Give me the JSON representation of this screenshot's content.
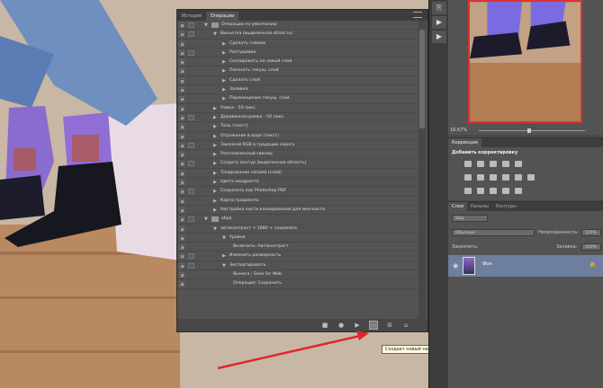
{
  "actions_panel": {
    "tabs": [
      "История",
      "Операции"
    ],
    "rows": [
      {
        "label": "Операции по умолчанию",
        "level": 0,
        "type": "set",
        "expanded": true,
        "dlg": true
      },
      {
        "label": "Виньетка (выделенная область)",
        "level": 1,
        "type": "action",
        "expanded": true,
        "dlg": true
      },
      {
        "label": "Сделать снимок",
        "level": 2,
        "type": "step",
        "expanded": false,
        "dlg": false
      },
      {
        "label": "Растушевка",
        "level": 2,
        "type": "step",
        "expanded": false,
        "dlg": true
      },
      {
        "label": "Скопировать на новый слой",
        "level": 2,
        "type": "step",
        "expanded": false,
        "dlg": false
      },
      {
        "label": "Показать текущ. слой",
        "level": 2,
        "type": "step",
        "expanded": false,
        "dlg": false
      },
      {
        "label": "Сделать слой",
        "level": 2,
        "type": "step",
        "expanded": false,
        "dlg": false
      },
      {
        "label": "Заливка",
        "level": 2,
        "type": "step",
        "expanded": false,
        "dlg": false
      },
      {
        "label": "Перемещение текущ. слой",
        "level": 2,
        "type": "step",
        "expanded": false,
        "dlg": false
      },
      {
        "label": "Рамка - 50 пикс.",
        "level": 1,
        "type": "action",
        "expanded": false,
        "dlg": false
      },
      {
        "label": "Деревянная рамка - 50 пикс.",
        "level": 1,
        "type": "action",
        "expanded": false,
        "dlg": true
      },
      {
        "label": "Тень (текст)",
        "level": 1,
        "type": "action",
        "expanded": false,
        "dlg": false
      },
      {
        "label": "Отражение в воде (текст)",
        "level": 1,
        "type": "action",
        "expanded": false,
        "dlg": false
      },
      {
        "label": "Заказной RGB в градации серого",
        "level": 1,
        "type": "action",
        "expanded": false,
        "dlg": true
      },
      {
        "label": "Расплавленный свинец",
        "level": 1,
        "type": "action",
        "expanded": false,
        "dlg": false
      },
      {
        "label": "Создать контур (выделенная область)",
        "level": 1,
        "type": "action",
        "expanded": false,
        "dlg": true
      },
      {
        "label": "Тонирование сепией (слой)",
        "level": 1,
        "type": "action",
        "expanded": false,
        "dlg": false
      },
      {
        "label": "Цвета квадранта",
        "level": 1,
        "type": "action",
        "expanded": false,
        "dlg": false
      },
      {
        "label": "Сохранить как Photoshop PDF",
        "level": 1,
        "type": "action",
        "expanded": false,
        "dlg": true
      },
      {
        "label": "Карта градиента",
        "level": 1,
        "type": "action",
        "expanded": false,
        "dlg": false
      },
      {
        "label": "Настройка кисти клонирования для мно-кисти",
        "level": 1,
        "type": "action",
        "expanded": false,
        "dlg": false
      },
      {
        "label": "обув",
        "level": 0,
        "type": "set",
        "expanded": true,
        "dlg": true
      },
      {
        "label": "автоконтраст + 1680 + сохранить",
        "level": 1,
        "type": "action",
        "expanded": true,
        "dlg": false
      },
      {
        "label": "Уровни",
        "level": 2,
        "type": "step",
        "expanded": true,
        "dlg": false
      },
      {
        "label": "Включить: Автоконтраст",
        "level": 3,
        "type": "detail",
        "expanded": false,
        "dlg": false
      },
      {
        "label": "Изменить размерность",
        "level": 2,
        "type": "step",
        "expanded": false,
        "dlg": true
      },
      {
        "label": "Экспортировать",
        "level": 2,
        "type": "step",
        "expanded": true,
        "dlg": true
      },
      {
        "label": "Вычисл.: Save for Web",
        "level": 3,
        "type": "detail",
        "expanded": false,
        "dlg": false
      },
      {
        "label": "Операция: Сохранить",
        "level": 3,
        "type": "detail",
        "expanded": false,
        "dlg": false
      }
    ],
    "tooltip": "Создает новый набор"
  },
  "navigator": {
    "zoom": "16.67%"
  },
  "corrections": {
    "tabs": [
      "Коррекция"
    ],
    "title": "Добавить корректировку"
  },
  "layers": {
    "tabs": [
      "Слои",
      "Каналы",
      "Контуры"
    ],
    "filter_label": "Вид",
    "blend_mode": "Обычные",
    "opacity_label": "Непрозрачность:",
    "opacity_value": "100%",
    "lock_label": "Закрепить:",
    "fill_label": "Заливка:",
    "fill_value": "100%",
    "layer_name": "Фон"
  },
  "colors": {
    "highlight": "#6d7f9c",
    "arrow": "#e0262a"
  }
}
